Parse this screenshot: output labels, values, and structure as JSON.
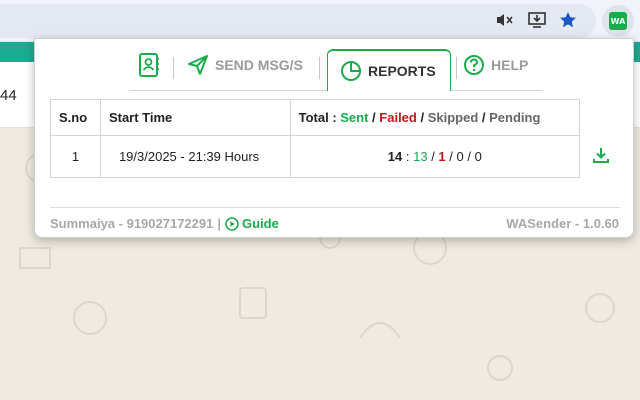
{
  "page": {
    "number_fragment": "44"
  },
  "extension": {
    "badge": "WA"
  },
  "popup": {
    "tabs": [
      {
        "name": "contacts",
        "label": ""
      },
      {
        "name": "send",
        "label": "SEND MSG/S"
      },
      {
        "name": "reports",
        "label": "REPORTS"
      },
      {
        "name": "help",
        "label": "HELP"
      }
    ],
    "table": {
      "headers": {
        "sno": "S.no",
        "start_time": "Start Time",
        "total_prefix": "Total : ",
        "sent": "Sent",
        "failed": "Failed",
        "skipped": "Skipped",
        "pending": "Pending",
        "sep": " / "
      },
      "rows": [
        {
          "sno": "1",
          "start_time": "19/3/2025 - 21:39 Hours",
          "total": "14",
          "sent": "13",
          "failed": "1",
          "skipped": "0",
          "pending": "0"
        }
      ]
    },
    "footer": {
      "user": "Summaiya - 919027172291",
      "divider": "|",
      "guide": "Guide",
      "version": "WASender - 1.0.60"
    }
  },
  "colors": {
    "accent_green": "#1aab4a",
    "failed_red": "#c01818",
    "whatsapp_teal": "#1dab92"
  }
}
